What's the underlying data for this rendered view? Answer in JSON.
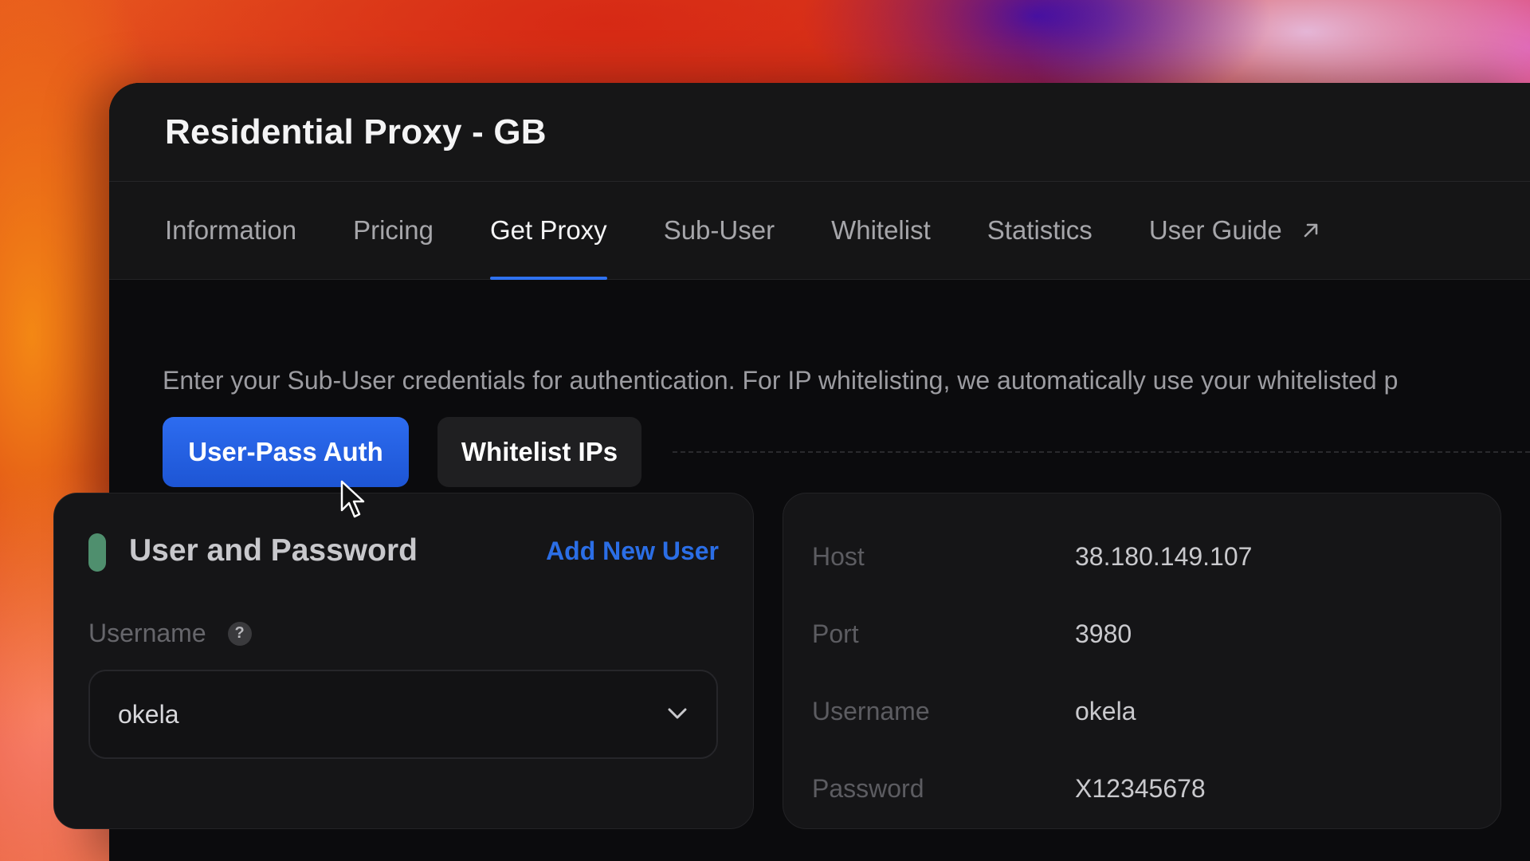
{
  "window": {
    "title": "Residential Proxy - GB"
  },
  "tabs": [
    {
      "label": "Information"
    },
    {
      "label": "Pricing"
    },
    {
      "label": "Get Proxy",
      "active": true
    },
    {
      "label": "Sub-User"
    },
    {
      "label": "Whitelist"
    },
    {
      "label": "Statistics"
    },
    {
      "label": "User Guide",
      "icon": "external-link-icon"
    }
  ],
  "hint": "Enter your Sub-User credentials for authentication. For IP whitelisting, we automatically use your whitelisted p",
  "auth": {
    "user_pass_label": "User-Pass Auth",
    "whitelist_label": "Whitelist IPs",
    "selected": "User-Pass Auth"
  },
  "credentials": {
    "title": "User and Password",
    "add_link": "Add New User",
    "username_label": "Username",
    "help_icon": "?",
    "username_value": "okela"
  },
  "details": {
    "rows": [
      {
        "key": "Host",
        "value": "38.180.149.107"
      },
      {
        "key": "Port",
        "value": "3980"
      },
      {
        "key": "Username",
        "value": "okela"
      },
      {
        "key": "Password",
        "value": "X12345678"
      }
    ]
  },
  "colors": {
    "accent": "#2f72f0",
    "primary_button": "#1d55d4",
    "status_pill": "#4f8f6e",
    "link": "#2b6ee6"
  }
}
